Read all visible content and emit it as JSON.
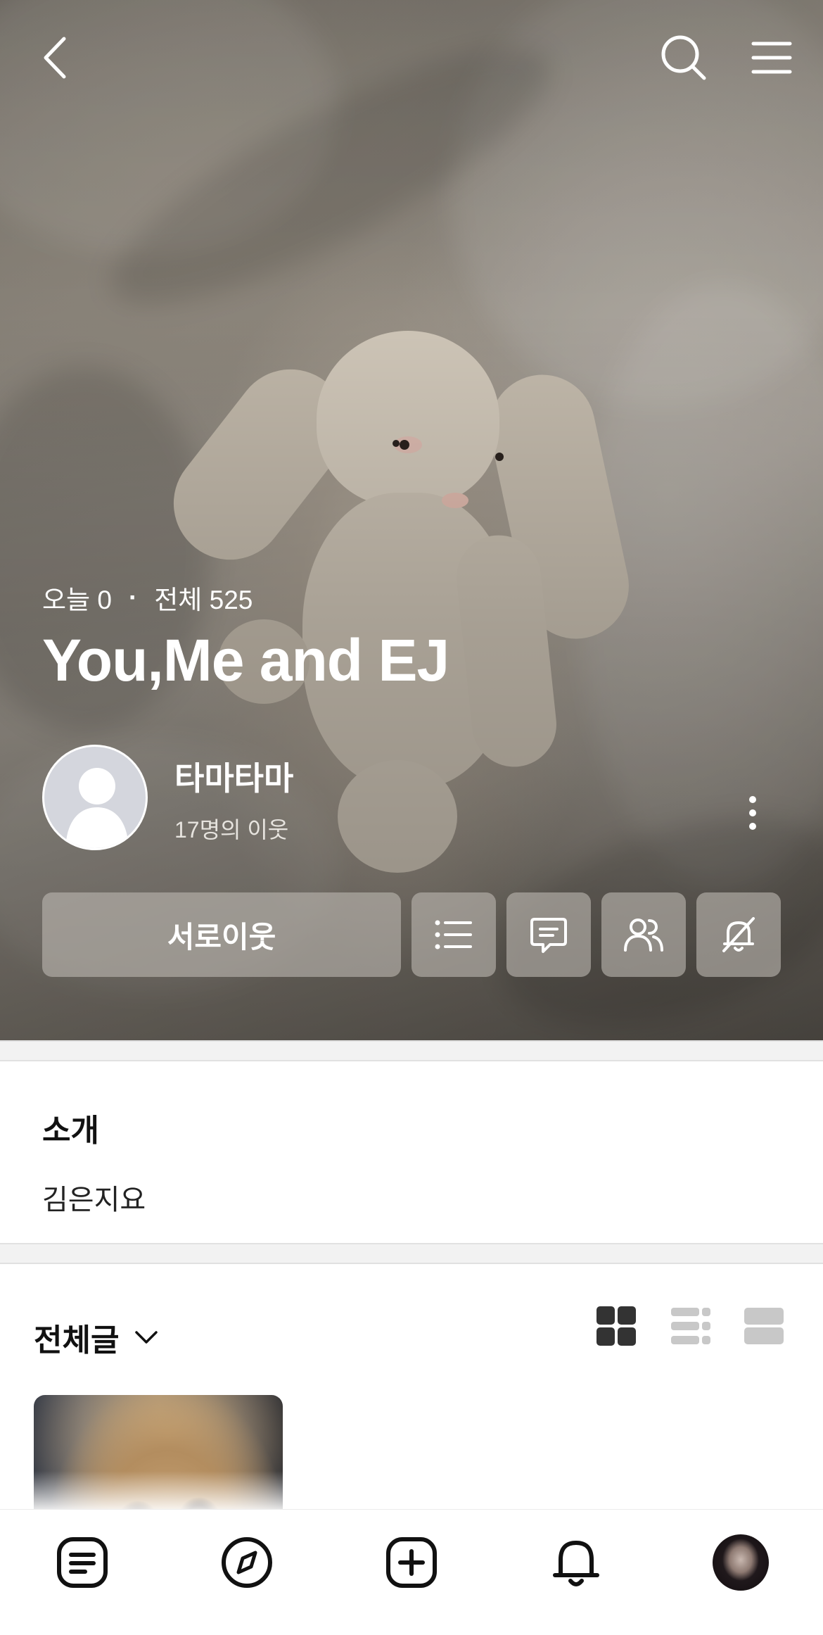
{
  "header": {
    "back_icon": "chevron-left-icon",
    "search_icon": "search-icon",
    "menu_icon": "hamburger-menu-icon"
  },
  "blog": {
    "today_label": "오늘 0",
    "separator": "·",
    "total_label": "전체 525",
    "title": "You,Me and EJ",
    "owner_name": "타마타마",
    "neighbor_count": "17명의 이웃"
  },
  "actions": {
    "primary_label": "서로이웃",
    "buttons": [
      "list-icon",
      "message-icon",
      "people-icon",
      "notification-off-icon"
    ]
  },
  "intro": {
    "heading": "소개",
    "text": "김은지요"
  },
  "posts": {
    "category_label": "전체글",
    "view_modes": [
      "grid-view-icon",
      "list-view-icon",
      "card-view-icon"
    ],
    "active_view": "grid-view-icon"
  },
  "bottom_nav": [
    "feed-icon",
    "compass-icon",
    "write-icon",
    "bell-icon",
    "profile-avatar"
  ],
  "colors": {
    "button_bg": "#bcb7b0",
    "active_icon": "#333333",
    "inactive_icon": "#c8c8c8"
  }
}
